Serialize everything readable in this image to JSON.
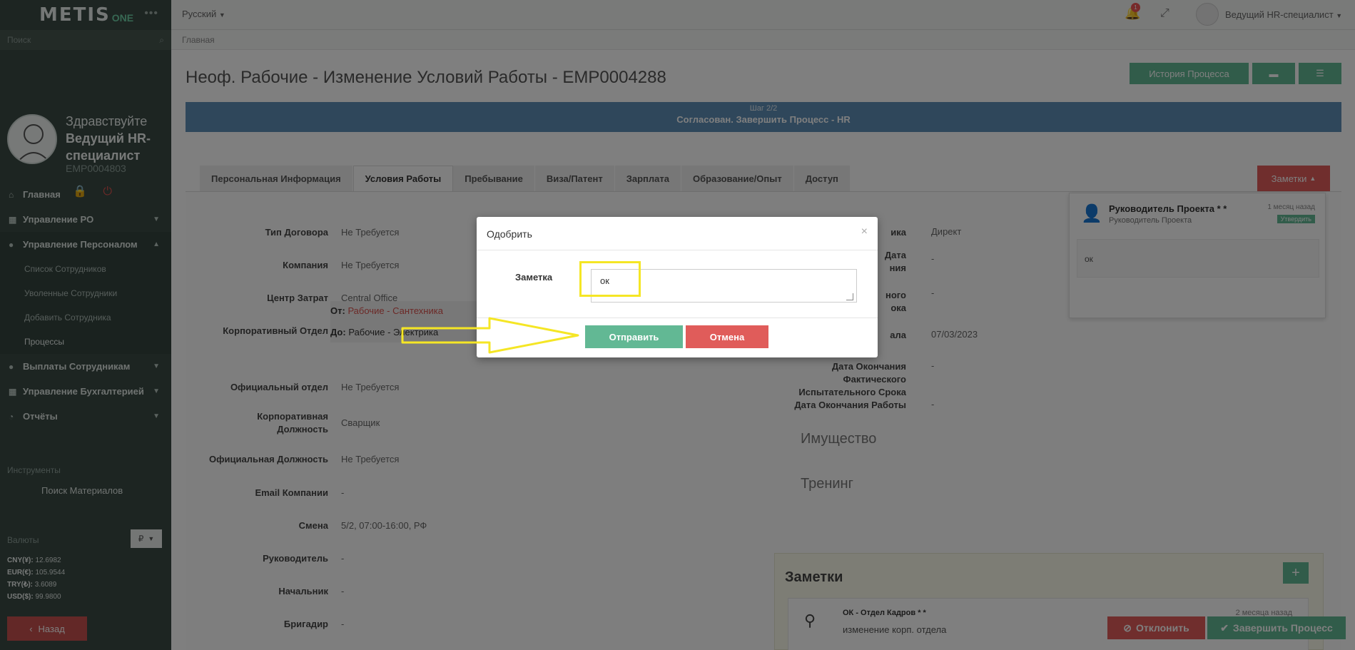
{
  "app": {
    "logo_main": "METIS",
    "logo_suffix": "ONE"
  },
  "sidebar": {
    "search_placeholder": "Поиск",
    "greeting": "Здравствуйте",
    "user_role": "Ведущий HR-специалист",
    "user_id": "EMP0004803",
    "nav": [
      {
        "label": "Главная",
        "icon": "home-icon",
        "expandable": false
      },
      {
        "label": "Управление PO",
        "icon": "building-icon",
        "expandable": true
      },
      {
        "label": "Управление Персоналом",
        "icon": "users-icon",
        "expandable": true,
        "expanded": true
      }
    ],
    "subnav": [
      {
        "label": "Список Сотрудников"
      },
      {
        "label": "Уволенные Сотрудники"
      },
      {
        "label": "Добавить Сотрудника"
      },
      {
        "label": "Процессы"
      }
    ],
    "nav2": [
      {
        "label": "Выплаты Сотрудникам",
        "icon": "payments-icon"
      },
      {
        "label": "Управление Бухгалтерией",
        "icon": "accounting-icon"
      },
      {
        "label": "Отчёты",
        "icon": "reports-icon"
      }
    ],
    "tools_label": "Инструменты",
    "tools_item": "Поиск Материалов",
    "currency_label": "Валюты",
    "currency_selected": "₽",
    "rates": [
      {
        "code": "CNY(¥):",
        "value": "12.6982"
      },
      {
        "code": "EUR(€):",
        "value": "105.9544"
      },
      {
        "code": "TRY(₺):",
        "value": "3.6089"
      },
      {
        "code": "USD($):",
        "value": "99.9800"
      }
    ],
    "back_label": "Назад"
  },
  "topbar": {
    "language": "Русский",
    "notification_count": "1",
    "user_name": "Ведущий HR-специалист"
  },
  "breadcrumb": "Главная",
  "page": {
    "title": "Неоф. Рабочие - Изменение Условий Работы - EMP0004288",
    "history_button": "История Процесса",
    "step": "Шаг 2/2",
    "status": "Согласован. Завершить Процесс - HR",
    "tabs": [
      {
        "label": "Персональная Информация"
      },
      {
        "label": "Условия Работы",
        "active": true
      },
      {
        "label": "Пребывание"
      },
      {
        "label": "Виза/Патент"
      },
      {
        "label": "Зарплата"
      },
      {
        "label": "Образование/Опыт"
      },
      {
        "label": "Доступ"
      }
    ],
    "notes_button": "Заметки"
  },
  "form_left": [
    {
      "label": "Тип Договора",
      "value": "Не Требуется"
    },
    {
      "label": "Компания",
      "value": "Не Требуется"
    },
    {
      "label": "Центр Затрат",
      "value": "Central Office"
    },
    {
      "label": "Корпоративный Отдел",
      "value": ""
    },
    {
      "label": "Официальный отдел",
      "value": "Не Требуется"
    },
    {
      "label": "Корпоративная Должность",
      "value": "Сварщик"
    },
    {
      "label": "Официальная Должность",
      "value": "Не Требуется"
    },
    {
      "label": "Email Компании",
      "value": "-"
    },
    {
      "label": "Смена",
      "value": "5/2, 07:00-16:00, РФ"
    },
    {
      "label": "Руководитель",
      "value": "-"
    },
    {
      "label": "Начальник",
      "value": "-"
    },
    {
      "label": "Бригадир",
      "value": "-"
    }
  ],
  "dept_change": {
    "from_label": "От:",
    "from_value": "Рабочие - Сантехника",
    "to_label": "До:",
    "to_value": "Рабочие - Электрика"
  },
  "form_right": [
    {
      "label": "ика",
      "value": "Директ"
    },
    {
      "label": "Дата\nния",
      "value": "-"
    },
    {
      "label": "ного\nока",
      "value": "-"
    },
    {
      "label": "ала",
      "value": "07/03/2023"
    },
    {
      "label": "Дата Окончания Фактического Испытательного Срока",
      "value": "-"
    },
    {
      "label": "Дата Окончания Работы",
      "value": "-"
    }
  ],
  "sections": {
    "property": "Имущество",
    "training": "Тренинг"
  },
  "notes_panel": {
    "title": "Заметки",
    "add": "+",
    "note_author": "ОК - Отдел Кадров * *",
    "note_text": "изменение корп. отдела",
    "note_time": "2 месяца назад"
  },
  "notes_popup": {
    "name": "Руководитель Проекта * *",
    "role": "Руководитель Проекта",
    "time": "1 месяц назад",
    "badge": "Утвердить",
    "message": "ок"
  },
  "footer_buttons": {
    "reject": "Отклонить",
    "complete": "Завершить Процесс"
  },
  "modal": {
    "title": "Одобрить",
    "close": "×",
    "field_label": "Заметка",
    "field_value": "ок",
    "submit": "Отправить",
    "cancel": "Отмена"
  },
  "colors": {
    "accent_green": "#62b894",
    "danger_red": "#e05c5a",
    "banner_blue": "#5f8fb6",
    "highlight_yellow": "#f5e625"
  }
}
